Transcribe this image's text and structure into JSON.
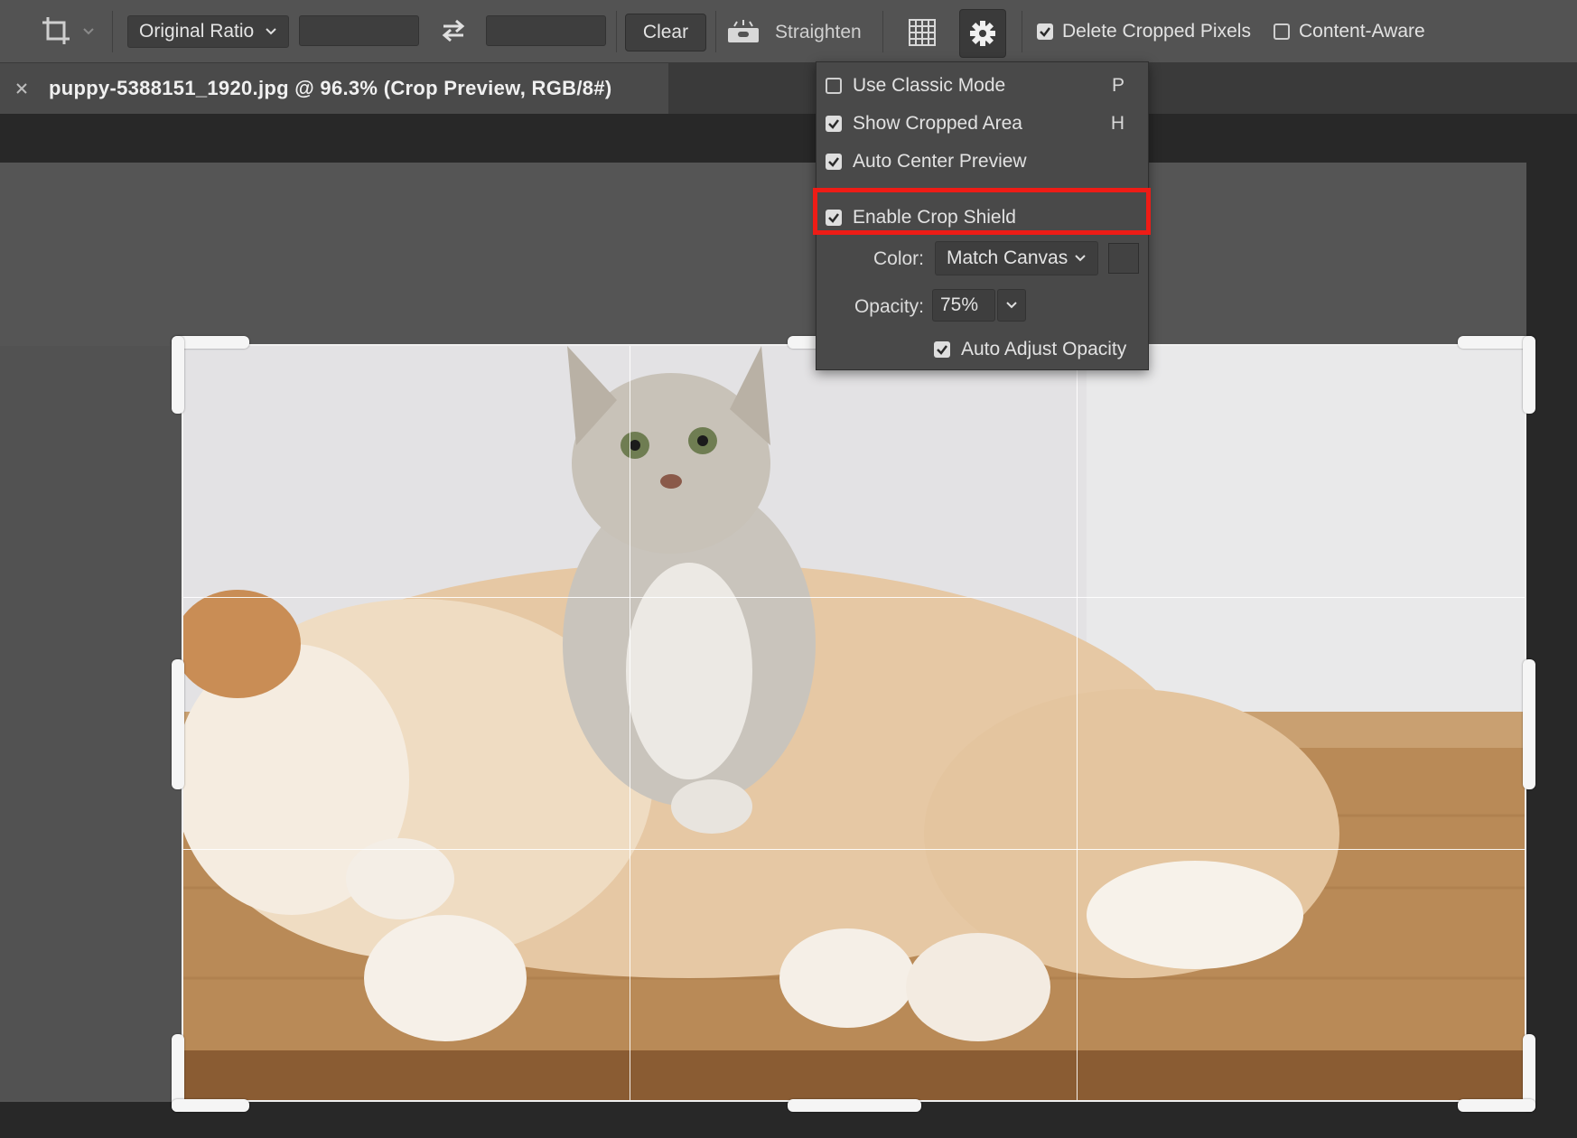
{
  "toolbar": {
    "aspect_ratio": "Original Ratio",
    "width_value": "",
    "height_value": "",
    "clear_label": "Clear",
    "straighten_label": "Straighten",
    "delete_cropped_label": "Delete Cropped Pixels",
    "delete_cropped_checked": true,
    "content_aware_label": "Content-Aware",
    "content_aware_checked": false
  },
  "document": {
    "tab_title": "puppy-5388151_1920.jpg @ 96.3% (Crop Preview, RGB/8#)"
  },
  "crop_settings": {
    "items": [
      {
        "label": "Use Classic Mode",
        "checked": false,
        "shortcut": "P"
      },
      {
        "label": "Show Cropped Area",
        "checked": true,
        "shortcut": "H"
      },
      {
        "label": "Auto Center Preview",
        "checked": true,
        "shortcut": ""
      },
      {
        "label": "Enable Crop Shield",
        "checked": true,
        "shortcut": ""
      }
    ],
    "color_label": "Color:",
    "color_value": "Match Canvas",
    "opacity_label": "Opacity:",
    "opacity_value": "75%",
    "auto_adjust_label": "Auto Adjust Opacity",
    "auto_adjust_checked": true,
    "highlight_color": "#ee1c16"
  }
}
